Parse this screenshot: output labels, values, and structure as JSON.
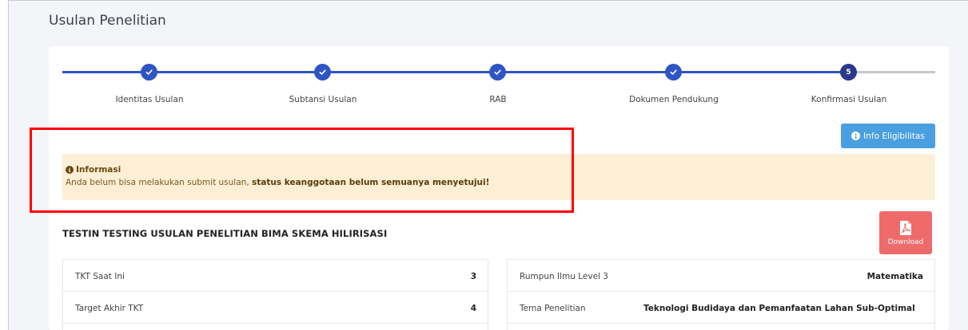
{
  "page": {
    "title": "Usulan Penelitian"
  },
  "stepper": {
    "steps": [
      {
        "label": "Identitas Usulan",
        "status": "done"
      },
      {
        "label": "Subtansi Usulan",
        "status": "done"
      },
      {
        "label": "RAB",
        "status": "done"
      },
      {
        "label": "Dokumen Pendukung",
        "status": "done"
      },
      {
        "label": "Konfirmasi Usulan",
        "status": "current",
        "number": "5"
      }
    ]
  },
  "info_button": {
    "label": "Info Eligibilitas",
    "icon": "info-circle-icon"
  },
  "alert": {
    "title": "Informasi",
    "message_prefix": "Anda belum bisa melakukan submit usulan,",
    "message_bold": "status keanggotaan belum semuanya menyetujui!"
  },
  "proposal": {
    "title": "TESTIN TESTING USULAN PENELITIAN BIMA SKEMA HILIRISASI",
    "download_label": "Download"
  },
  "details_left": [
    {
      "label": "TKT Saat Ini",
      "value": "3"
    },
    {
      "label": "Target Akhir TKT",
      "value": "4"
    }
  ],
  "details_right": [
    {
      "label": "Rumpun Ilmu Level 3",
      "value": "Matematika"
    },
    {
      "label": "Tema Penelitian",
      "value": "Teknologi Budidaya dan Pemanfaatan Lahan Sub-Optimal"
    }
  ],
  "colors": {
    "primary": "#2f55c5",
    "info": "#4a9fe0",
    "warning_bg": "#fcefd6",
    "danger": "#ef6b6b",
    "highlight_box": "#ff0000"
  }
}
